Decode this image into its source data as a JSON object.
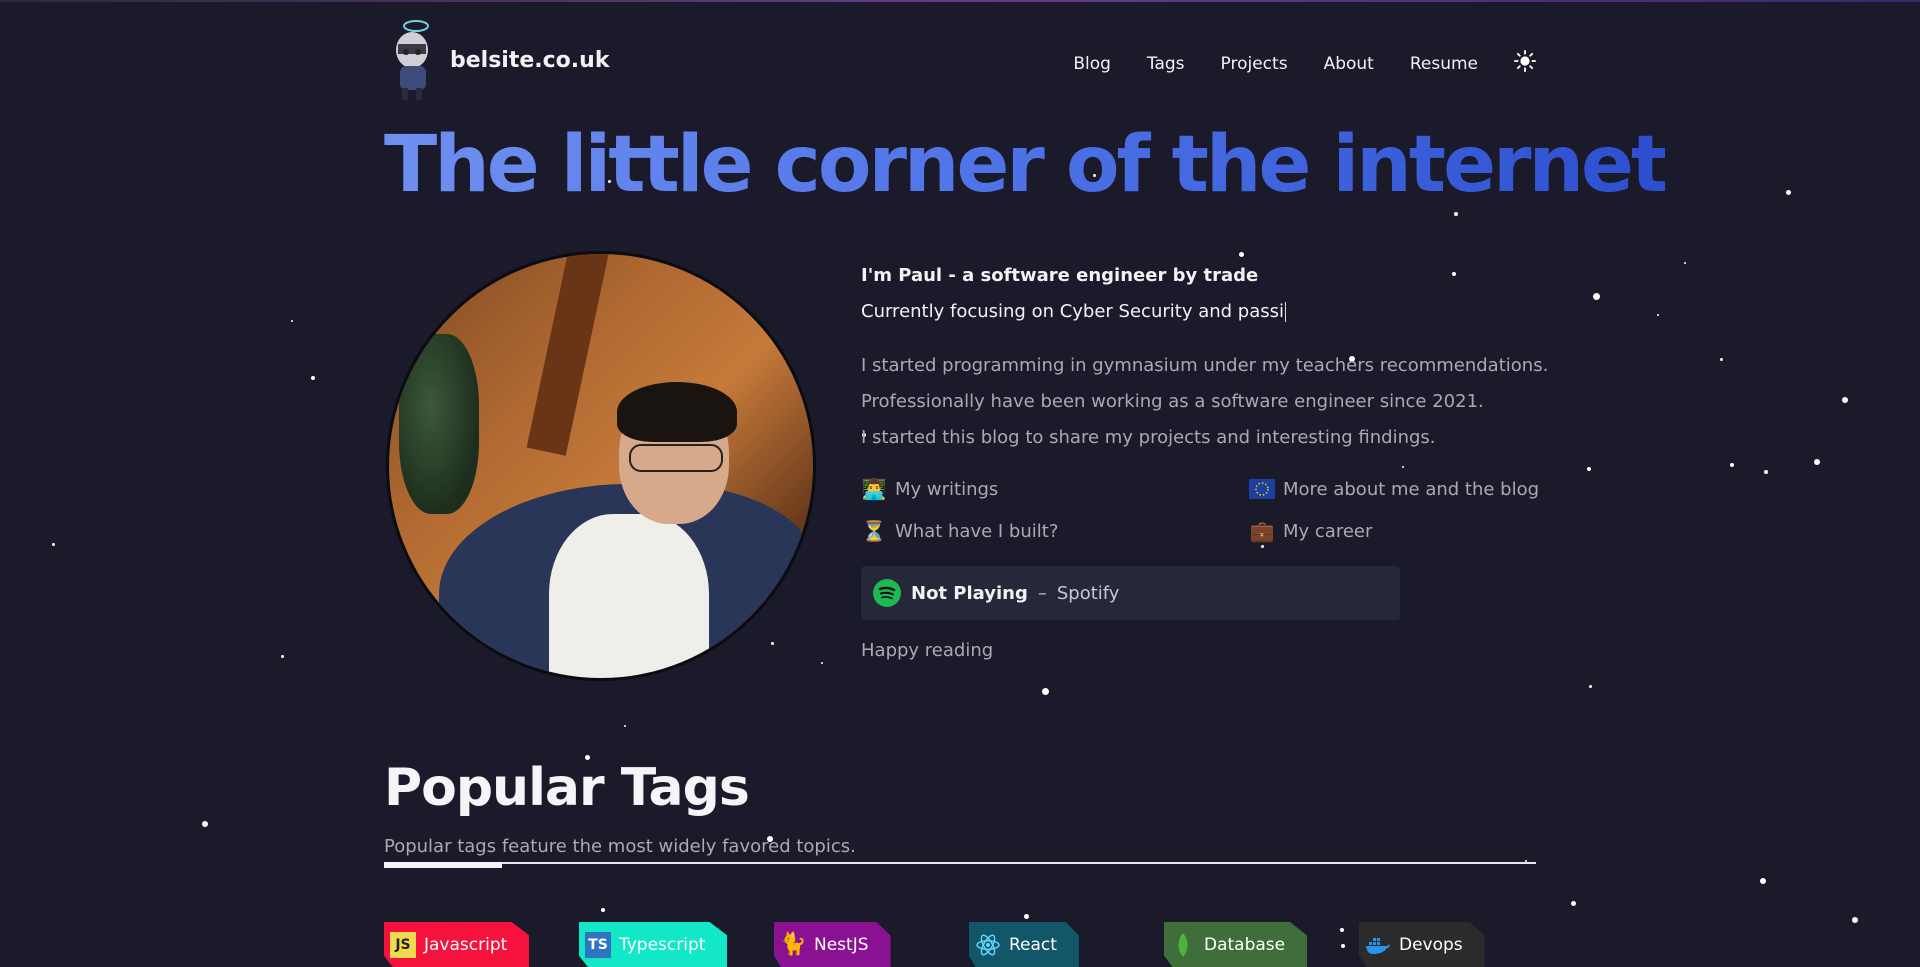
{
  "site": {
    "name": "belsite.co.uk"
  },
  "nav": {
    "items": [
      "Blog",
      "Tags",
      "Projects",
      "About",
      "Resume"
    ],
    "theme_toggle_icon": "sun-icon"
  },
  "hero": {
    "title": "The little corner of the internet",
    "greeting": "I'm Paul - a software engineer by trade",
    "typing_line": "Currently focusing on Cyber Security and passi",
    "bio": [
      "I started programming in gymnasium under my teachers recommendations.",
      "Professionally have been working as a software engineer since 2021.",
      "I started this blog to share my projects and interesting findings."
    ]
  },
  "links": [
    {
      "label": "My writings",
      "icon": "technologist-emoji-icon"
    },
    {
      "label": "More about me and the blog",
      "icon": "eu-flag-icon"
    },
    {
      "label": "What have I built?",
      "icon": "hourglass-icon"
    },
    {
      "label": "My career",
      "icon": "briefcase-icon"
    }
  ],
  "spotify": {
    "status": "Not Playing",
    "separator": "–",
    "source": "Spotify",
    "icon": "spotify-icon",
    "color": "#1DB954"
  },
  "closing": "Happy reading",
  "popular_tags": {
    "title": "Popular Tags",
    "subtitle": "Popular tags feature the most widely favored topics.",
    "tags": [
      {
        "label": "Javascript",
        "color": "#f5123c",
        "icon": "javascript-icon"
      },
      {
        "label": "Typescript",
        "color": "#12e8c8",
        "icon": "typescript-icon"
      },
      {
        "label": "NestJS",
        "color": "#8a1292",
        "icon": "nestjs-icon"
      },
      {
        "label": "React",
        "color": "#12566a",
        "icon": "react-icon"
      },
      {
        "label": "Database",
        "color": "#3f6e3a",
        "icon": "database-icon"
      },
      {
        "label": "Devops",
        "color": "#2b2b2b",
        "icon": "docker-icon"
      }
    ]
  }
}
